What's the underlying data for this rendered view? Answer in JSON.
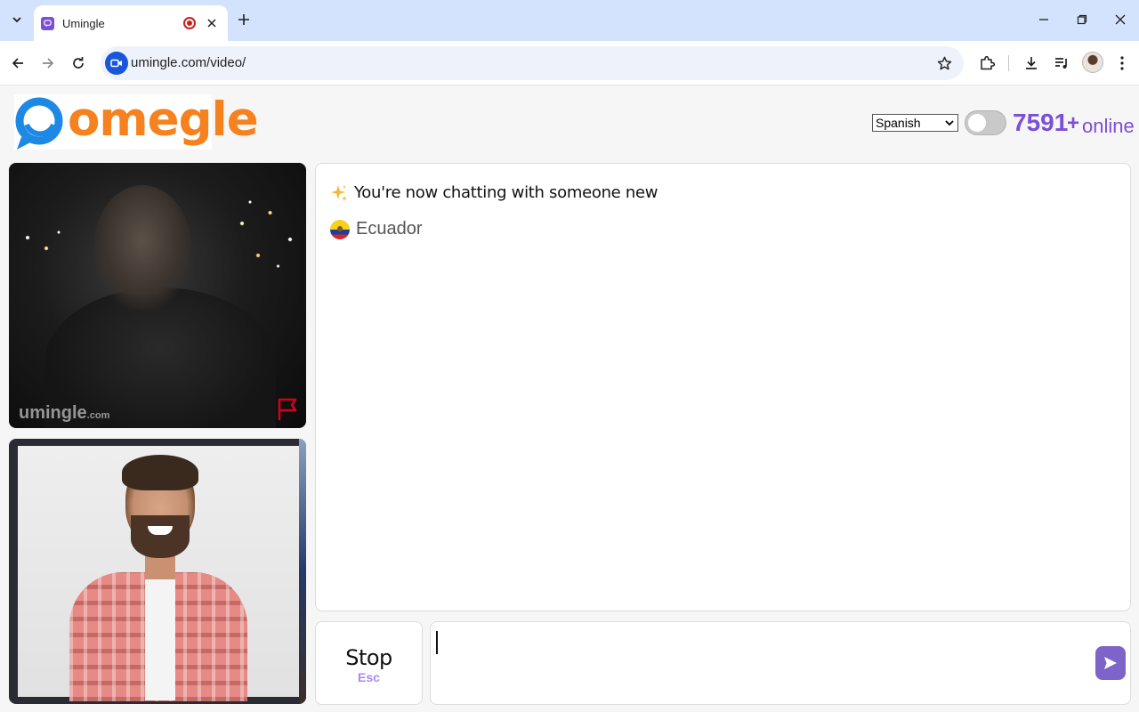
{
  "browser": {
    "tab_title": "Umingle",
    "url": "umingle.com/video/"
  },
  "colors": {
    "brand_orange": "#f5811f",
    "brand_blue": "#1e88e5",
    "accent_purple": "#7b4fd6",
    "send_button": "#7e63c9",
    "report_red": "#d0021b"
  },
  "header": {
    "logo_text": "omegle",
    "language": {
      "selected": "Spanish"
    },
    "online": {
      "count": "7591",
      "plus": "+",
      "label": "online"
    }
  },
  "videos": {
    "stranger_watermark": "umingle",
    "stranger_watermark_suffix": ".com"
  },
  "chat": {
    "system_message": "You're now chatting with someone new",
    "country": "Ecuador"
  },
  "controls": {
    "stop_label": "Stop",
    "stop_hint": "Esc",
    "message_value": ""
  },
  "icons": {
    "tab_search": "chevron-down-icon",
    "favicon": "umingle-favicon-icon",
    "recording": "recording-icon",
    "close_tab": "close-icon",
    "new_tab": "plus-icon",
    "back": "arrow-left-icon",
    "forward": "arrow-right-icon",
    "reload": "reload-icon",
    "site_info": "video-camera-icon",
    "bookmark": "star-icon",
    "extensions": "puzzle-icon",
    "downloads": "download-icon",
    "media": "media-control-icon",
    "menu": "kebab-menu-icon",
    "report": "flag-icon",
    "sparkle": "sparkle-icon",
    "country_flag": "ecuador-flag-icon",
    "send": "send-icon"
  }
}
